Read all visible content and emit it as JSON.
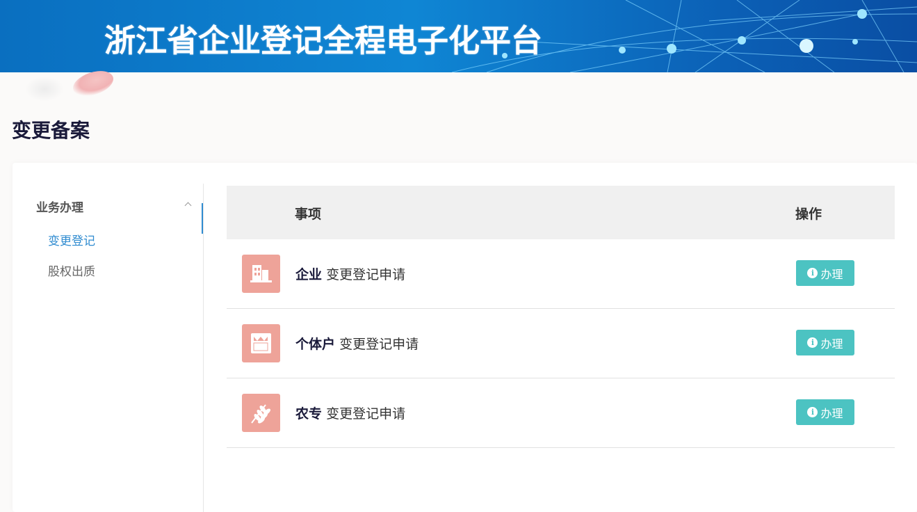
{
  "banner": {
    "title": "浙江省企业登记全程电子化平台"
  },
  "page": {
    "title": "变更备案"
  },
  "sidebar": {
    "group_label": "业务办理",
    "items": [
      {
        "label": "变更登记",
        "active": true
      },
      {
        "label": "股权出质",
        "active": false
      }
    ]
  },
  "table": {
    "headers": {
      "item": "事项",
      "action": "操作"
    },
    "rows": [
      {
        "icon": "building-icon",
        "type": "企业",
        "desc": "变更登记申请",
        "button": "办理"
      },
      {
        "icon": "shop-icon",
        "type": "个体户",
        "desc": "变更登记申请",
        "button": "办理"
      },
      {
        "icon": "wheat-icon",
        "type": "农专",
        "desc": "变更登记申请",
        "button": "办理"
      }
    ]
  },
  "colors": {
    "accent": "#2f8bd0",
    "button": "#4cc3c2",
    "row_icon_bg": "#eea399",
    "banner_blue": "#0f86d4"
  }
}
